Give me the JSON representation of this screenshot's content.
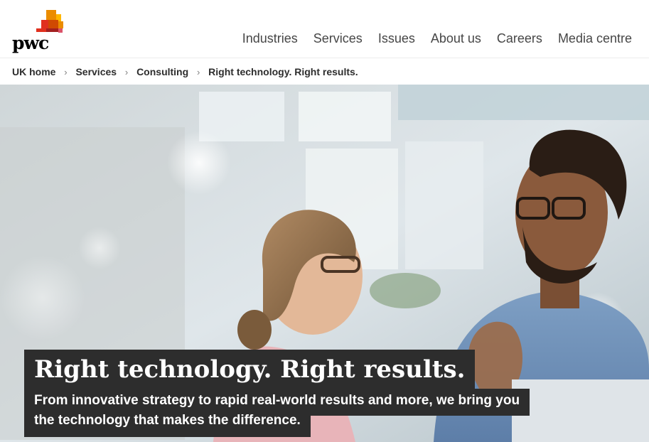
{
  "brand": {
    "name": "pwc",
    "accent": "#d04a02",
    "accent2": "#eb8c00",
    "accent3": "#e0301e"
  },
  "nav": {
    "items": [
      {
        "label": "Industries"
      },
      {
        "label": "Services"
      },
      {
        "label": "Issues"
      },
      {
        "label": "About us"
      },
      {
        "label": "Careers"
      },
      {
        "label": "Media centre"
      }
    ]
  },
  "breadcrumb": {
    "items": [
      {
        "label": "UK home"
      },
      {
        "label": "Services"
      },
      {
        "label": "Consulting"
      }
    ],
    "current": "Right technology. Right results.",
    "separator": "›"
  },
  "hero": {
    "title": "Right technology. Right results.",
    "subtitle_line1": "From innovative strategy to rapid real-world results and more, we bring you",
    "subtitle_line2": "the technology that makes the difference."
  }
}
